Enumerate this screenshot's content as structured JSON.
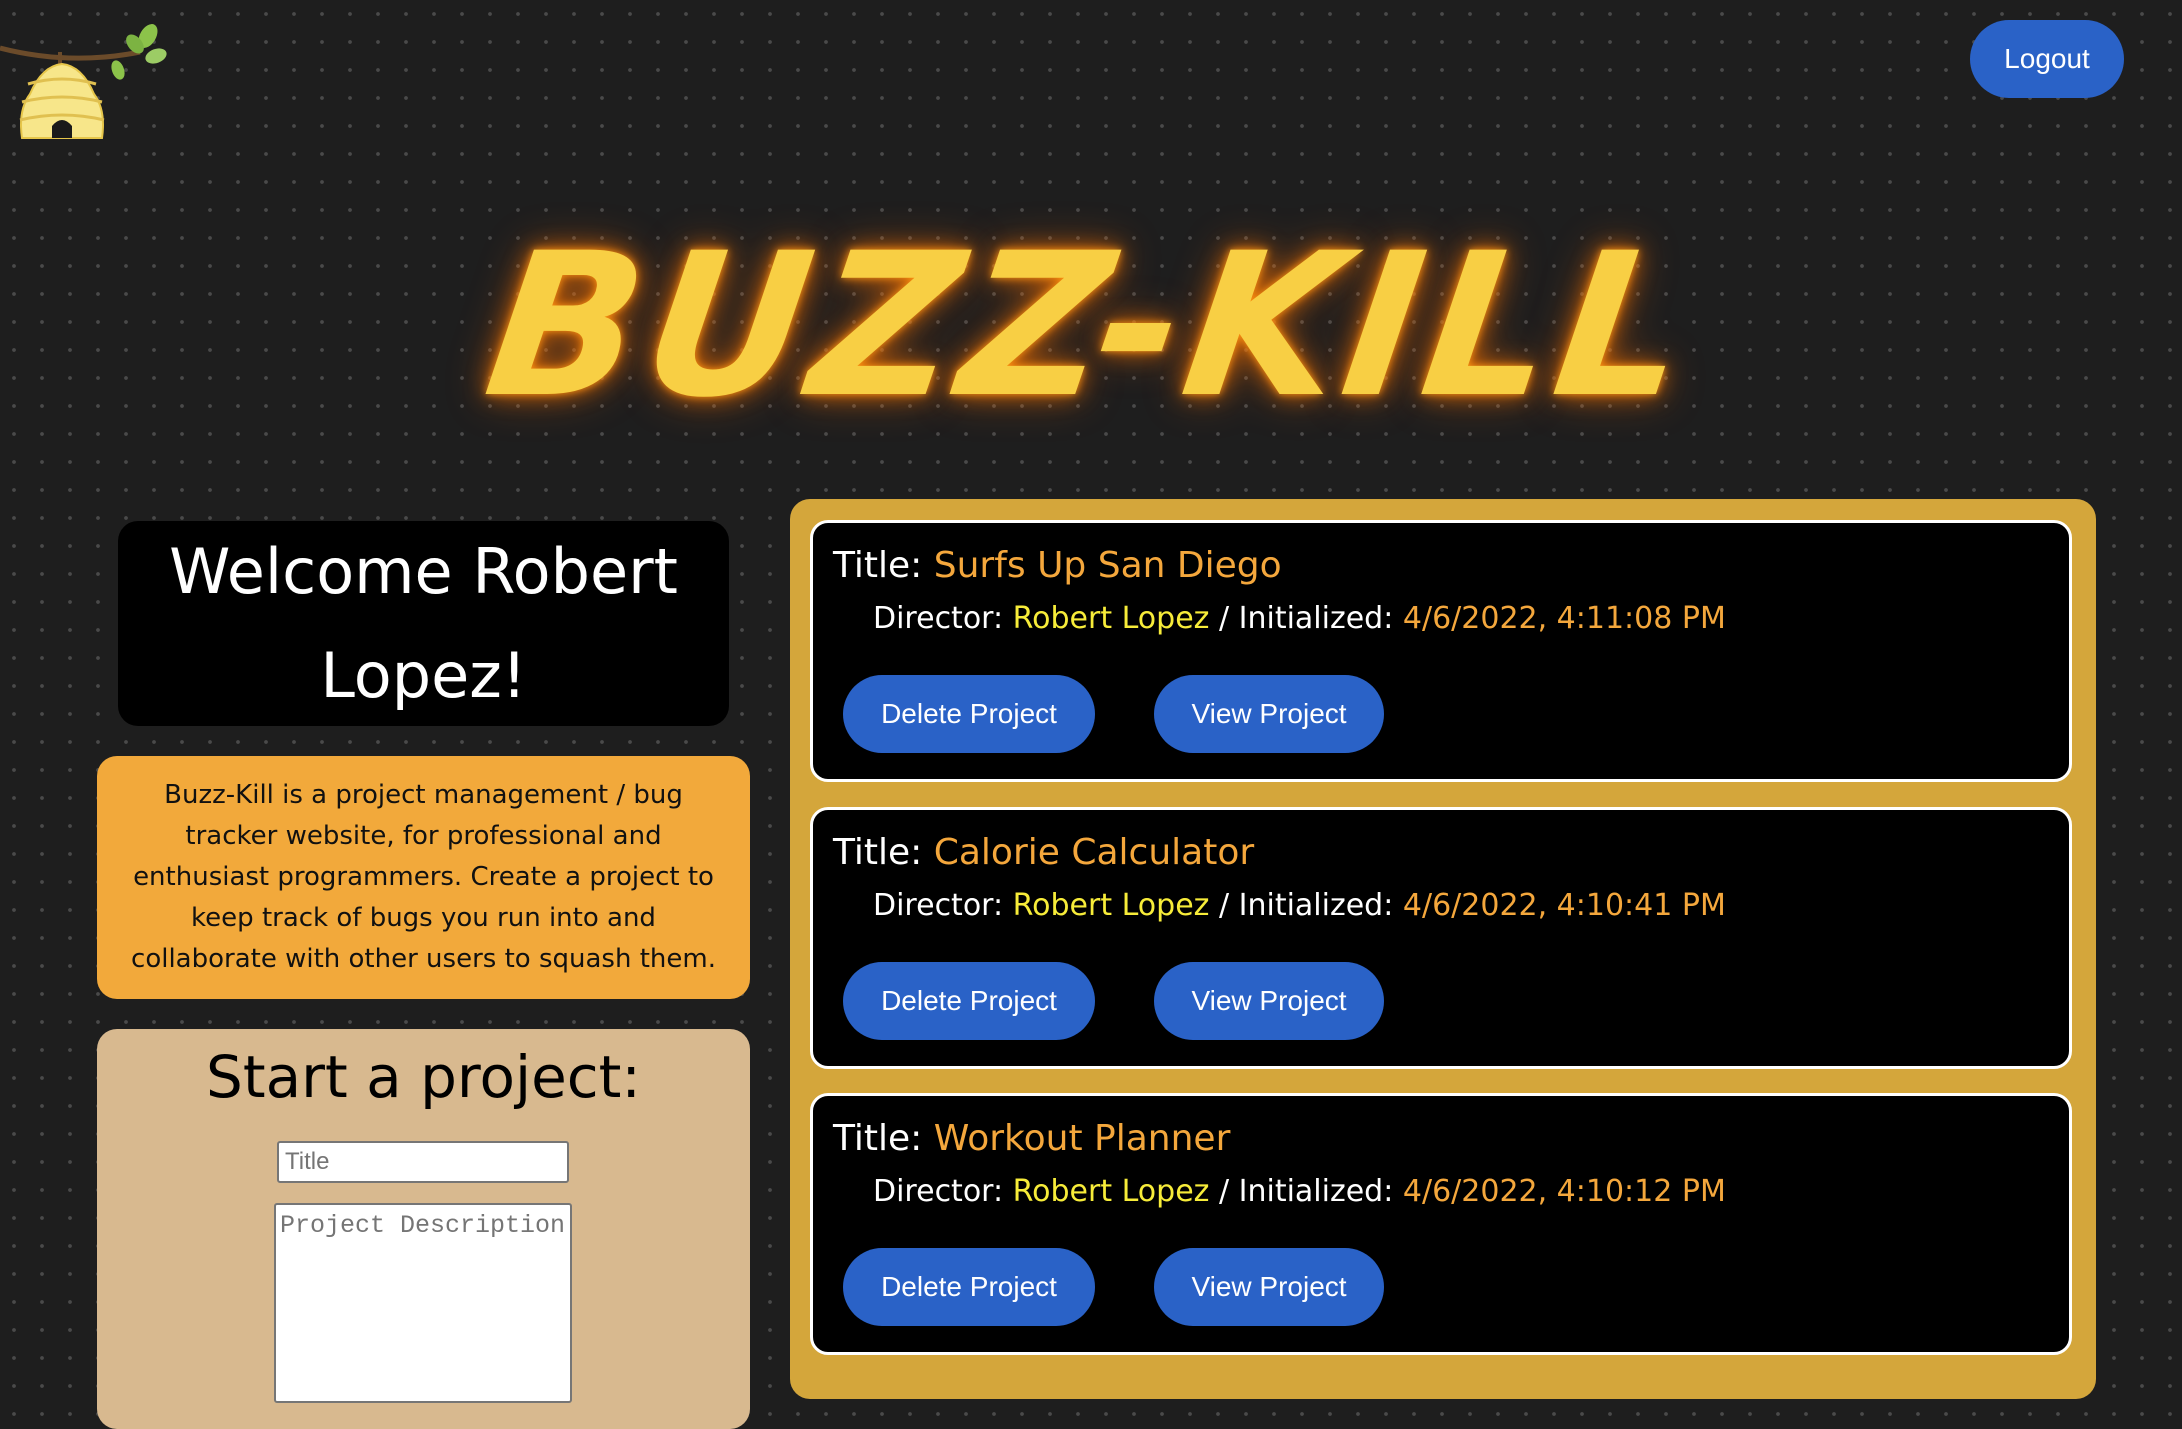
{
  "header": {
    "logout_label": "Logout",
    "brand_title": "BUZZ-KILL",
    "logo_icon": "beehive-icon"
  },
  "welcome": {
    "text": "Welcome Robert Lopez!"
  },
  "about": {
    "text": "Buzz-Kill is a project management / bug tracker website, for professional and enthusiast programmers. Create a project to keep track of bugs you run into and collaborate with other users to squash them."
  },
  "start_project": {
    "heading": "Start a project:",
    "title_placeholder": "Title",
    "description_placeholder": "Project Description"
  },
  "labels": {
    "title": "Title:",
    "director": "Director:",
    "initialized": "Initialized:",
    "separator": "/",
    "delete": "Delete Project",
    "view": "View Project"
  },
  "projects": [
    {
      "title": "Surfs Up San Diego",
      "director": "Robert Lopez",
      "initialized": "4/6/2022, 4:11:08 PM"
    },
    {
      "title": "Calorie Calculator",
      "director": "Robert Lopez",
      "initialized": "4/6/2022, 4:10:41 PM"
    },
    {
      "title": "Workout Planner",
      "director": "Robert Lopez",
      "initialized": "4/6/2022, 4:10:12 PM"
    }
  ],
  "colors": {
    "background": "#1e1e1e",
    "brand_yellow": "#f8cf44",
    "button_blue": "#2a62c7",
    "about_orange": "#f2a93b",
    "panel_gold": "#d4a63b",
    "form_tan": "#d8b98f",
    "accent_orange": "#f4a73c",
    "director_yellow": "#f7ec39"
  }
}
